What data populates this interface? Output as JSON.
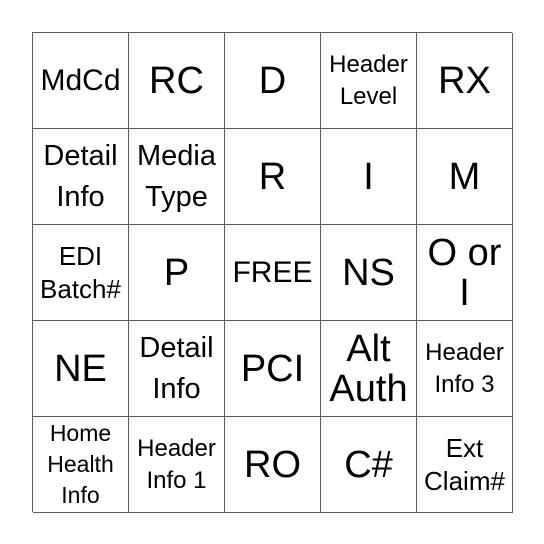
{
  "card": {
    "cells": [
      {
        "text": "MdCd",
        "size": "l"
      },
      {
        "text": "RC",
        "size": "xl"
      },
      {
        "text": "D",
        "size": "xl"
      },
      {
        "text": "Header\nLevel",
        "size": "s"
      },
      {
        "text": "RX",
        "size": "xl"
      },
      {
        "text": "Detail\nInfo",
        "size": "m"
      },
      {
        "text": "Media\nType",
        "size": "m"
      },
      {
        "text": "R",
        "size": "xl"
      },
      {
        "text": "I",
        "size": "xl"
      },
      {
        "text": "M",
        "size": "xl"
      },
      {
        "text": "EDI\nBatch#",
        "size": "md"
      },
      {
        "text": "P",
        "size": "xl"
      },
      {
        "text": "FREE",
        "size": "l"
      },
      {
        "text": "NS",
        "size": "xl"
      },
      {
        "text": "O or\nI",
        "size": "xl"
      },
      {
        "text": "NE",
        "size": "xl"
      },
      {
        "text": "Detail\nInfo",
        "size": "m"
      },
      {
        "text": "PCI",
        "size": "xl"
      },
      {
        "text": "Alt\nAuth",
        "size": "xl"
      },
      {
        "text": "Header\nInfo 3",
        "size": "s"
      },
      {
        "text": "Home\nHealth\nInfo",
        "size": "xs"
      },
      {
        "text": "Header\nInfo 1",
        "size": "s"
      },
      {
        "text": "RO",
        "size": "xl"
      },
      {
        "text": "C#",
        "size": "xl"
      },
      {
        "text": "Ext\nClaim#",
        "size": "md"
      }
    ]
  }
}
